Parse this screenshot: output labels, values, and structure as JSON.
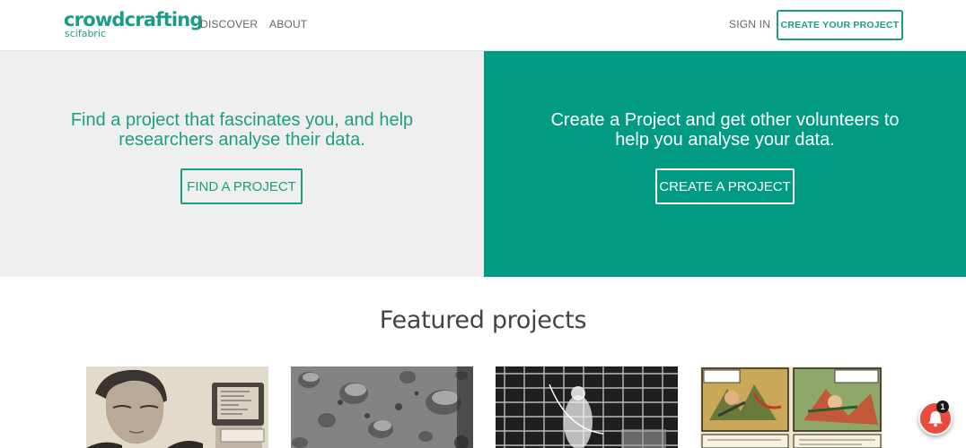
{
  "header": {
    "logo_main": "crowdcrafting",
    "logo_sub": "scifabric",
    "nav": [
      {
        "label": "DISCOVER"
      },
      {
        "label": "ABOUT"
      }
    ],
    "sign_in_label": "SIGN IN",
    "create_project_label": "CREATE YOUR PROJECT"
  },
  "hero": {
    "left": {
      "text_line1": "Find a project that fascinates you, and help",
      "text_line2": "researchers analyse their data.",
      "button_label": "FIND A PROJECT"
    },
    "right": {
      "text_line1": "Create a Project and get other volunteers to",
      "text_line2": "help you analyse your data.",
      "button_label": "CREATE A PROJECT"
    }
  },
  "featured": {
    "title": "Featured projects",
    "cards": [
      {
        "image": "man-with-computer-photo"
      },
      {
        "image": "moon-craters-photo"
      },
      {
        "image": "physicist-experiment-photo"
      },
      {
        "image": "comic-book-page"
      }
    ]
  },
  "notification": {
    "count": "1",
    "icon": "bell-icon"
  },
  "colors": {
    "brand": "#199e84",
    "hero_right_bg": "#019a82",
    "hero_left_bg": "#efefef",
    "notification": "#e84c3d"
  }
}
